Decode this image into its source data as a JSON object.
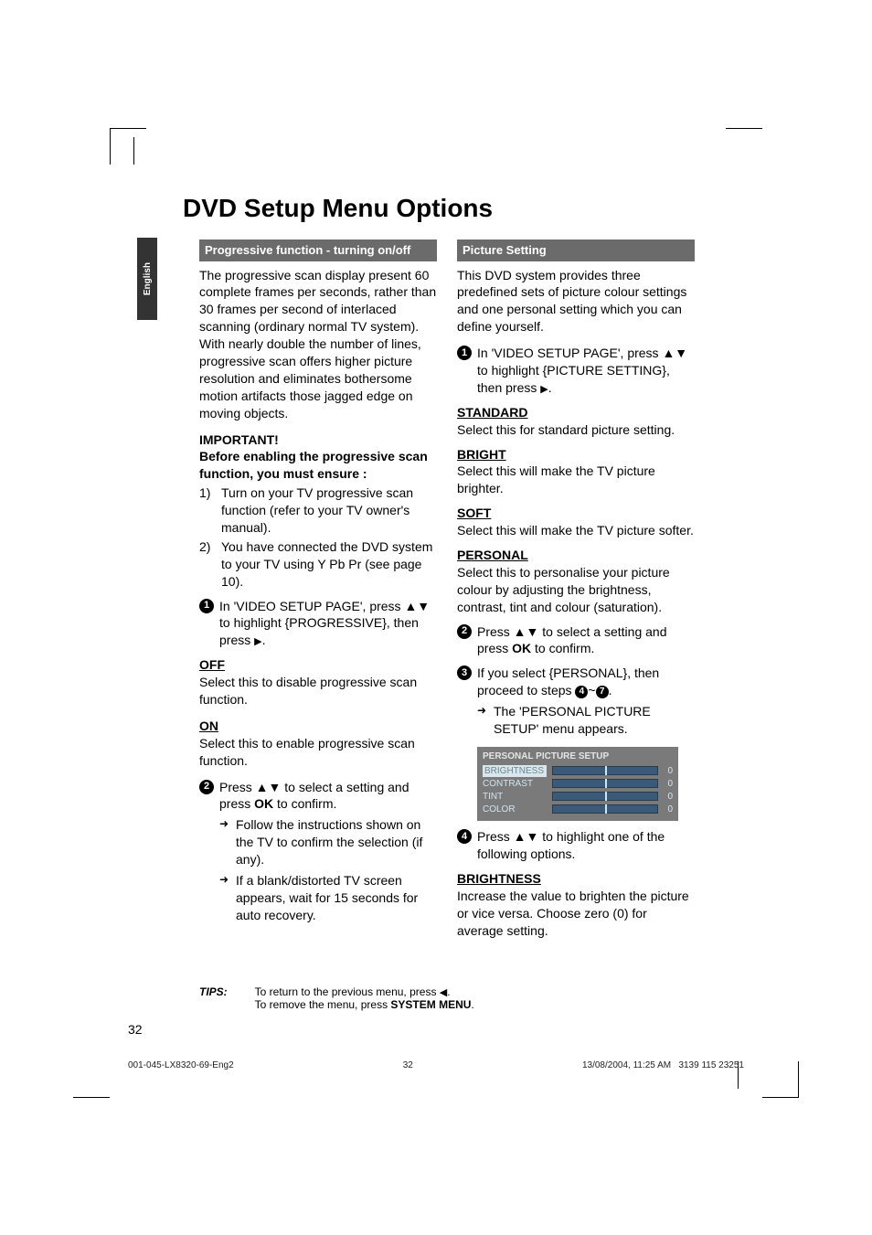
{
  "title": "DVD Setup Menu Options",
  "langTab": "English",
  "left": {
    "bar": "Progressive function - turning on/off",
    "intro": "The progressive scan display present 60 complete frames per seconds, rather than 30 frames per second of interlaced scanning (ordinary normal TV system). With nearly double the number of lines, progressive scan offers higher picture resolution and eliminates bothersome motion artifacts those jagged edge on moving objects.",
    "important": "IMPORTANT!",
    "before": "Before enabling the progressive scan function, you must ensure :",
    "li1idx": "1)",
    "li1": "Turn on your TV progressive scan function (refer to your TV owner's manual).",
    "li2idx": "2)",
    "li2": "You have connected the DVD system to your TV using Y Pb Pr (see page 10).",
    "s1n": "1",
    "s1a": "In 'VIDEO SETUP PAGE', press ▲▼ to highlight {PROGRESSIVE}, then press ",
    "s1b": "▶",
    "s1c": ".",
    "offH": "OFF",
    "offT": "Select this to disable progressive scan function.",
    "onH": "ON",
    "onT": "Select this to enable progressive scan function.",
    "s2n": "2",
    "s2a": "Press ▲▼  to select a setting and press ",
    "ok": "OK",
    "s2b": " to confirm.",
    "ar1": "Follow the instructions shown on the TV to confirm the selection (if any).",
    "ar2": "If a blank/distorted TV screen appears, wait for 15 seconds for auto recovery."
  },
  "right": {
    "bar": "Picture Setting",
    "intro": "This DVD system provides three predefined sets of picture colour settings and one personal setting which you can define yourself.",
    "s1n": "1",
    "s1a": "In 'VIDEO SETUP PAGE', press ▲▼ to highlight {PICTURE SETTING}, then press ",
    "s1b": "▶",
    "s1c": ".",
    "stdH": "STANDARD",
    "stdT": "Select this for standard picture setting.",
    "brH": "BRIGHT",
    "brT": "Select this will make the TV picture brighter.",
    "soH": "SOFT",
    "soT": "Select this will make the TV picture softer.",
    "peH": "PERSONAL",
    "peT": "Select this to personalise your picture colour by adjusting the brightness, contrast, tint and colour (saturation).",
    "s2n": "2",
    "s2a": "Press ▲▼  to select a setting and press ",
    "ok": "OK",
    "s2b": " to confirm.",
    "s3n": "3",
    "s3a": "If you select {PERSONAL}, then proceed to steps ",
    "c4": "4",
    "tildeDash": "~",
    "c7": "7",
    "s3b": ".",
    "ar1": "The 'PERSONAL PICTURE SETUP' menu appears.",
    "box": {
      "hdr": "PERSONAL PICTURE SETUP",
      "r1": "BRIGHTNESS",
      "v1": "0",
      "r2": "CONTRAST",
      "v2": "0",
      "r3": "TINT",
      "v3": "0",
      "r4": "COLOR",
      "v4": "0"
    },
    "s4n": "4",
    "s4": "Press ▲▼ to highlight one of the following options.",
    "briH": "BRIGHTNESS",
    "briT": "Increase the value to brighten the picture or vice versa. Choose zero (0) for average setting."
  },
  "tips": {
    "label": "TIPS:",
    "l1a": "To return to the previous menu, press ",
    "l1b": "◀",
    "l1c": ".",
    "l2a": "To remove the menu, press ",
    "l2b": "SYSTEM MENU",
    "l2c": "."
  },
  "pageNum": "32",
  "footer": {
    "left": "001-045-LX8320-69-Eng2",
    "mid": "32",
    "rightA": "13/08/2004, 11:25 AM",
    "rightB": "3139 115 23251"
  }
}
